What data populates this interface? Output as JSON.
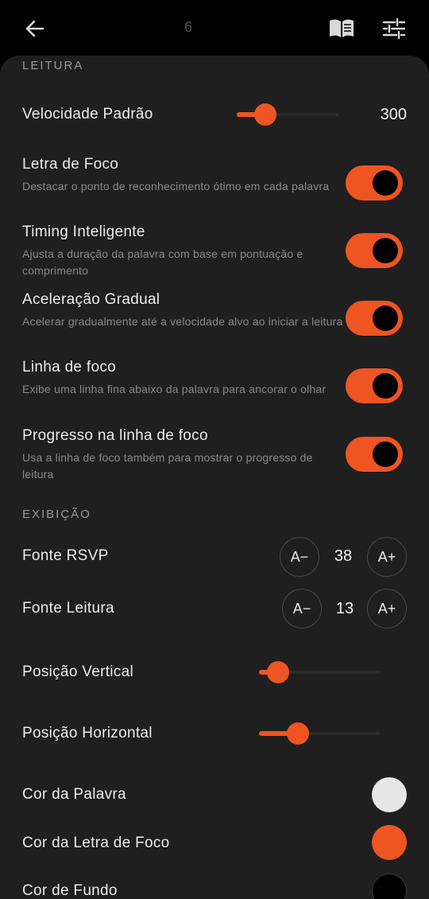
{
  "header": {
    "page_number": "6",
    "back_icon": "arrow-left-icon",
    "book_icon": "book-open-icon",
    "settings_icon": "tune-sliders-icon"
  },
  "reading": {
    "section_title": "LEITURA",
    "default_speed": {
      "label": "Velocidade Padrão",
      "value": "300",
      "slider_fraction": 0.28
    },
    "toggles": [
      {
        "title": "Letra de Foco",
        "desc": "Destacar o ponto de reconhecimento ótimo em cada palavra",
        "on": true
      },
      {
        "title": "Timing Inteligente",
        "desc": "Ajusta a duração da palavra com base em pontuação e comprimento",
        "on": true
      },
      {
        "title": "Aceleração Gradual",
        "desc": "Acelerar gradualmente até a velocidade alvo ao iniciar a leitura",
        "on": true
      },
      {
        "title": "Linha de foco",
        "desc": "Exibe uma linha fina abaixo da palavra para ancorar o olhar",
        "on": true
      },
      {
        "title": "Progresso na linha de foco",
        "desc": "Usa a linha de foco também para mostrar o progresso de leitura",
        "on": true
      }
    ]
  },
  "display": {
    "section_title": "EXIBIÇÃO",
    "rsvp_font": {
      "label": "Fonte RSVP",
      "value": "38",
      "decrease": "A−",
      "increase": "A+"
    },
    "reading_font": {
      "label": "Fonte Leitura",
      "value": "13",
      "decrease": "A−",
      "increase": "A+"
    },
    "vertical_position": {
      "label": "Posição Vertical",
      "slider_fraction": 0.16
    },
    "horizontal_position": {
      "label": "Posição Horizontal",
      "slider_fraction": 0.32
    },
    "word_color": {
      "label": "Cor da Palavra",
      "color": "#e6e6e6"
    },
    "focus_letter_color": {
      "label": "Cor da Letra de Foco",
      "color": "#ef5423"
    },
    "background_color": {
      "label": "Cor de Fundo",
      "color": "#000000"
    }
  },
  "theme": {
    "accent": "#ef5423",
    "sheet_bg": "#1f1f1f"
  }
}
